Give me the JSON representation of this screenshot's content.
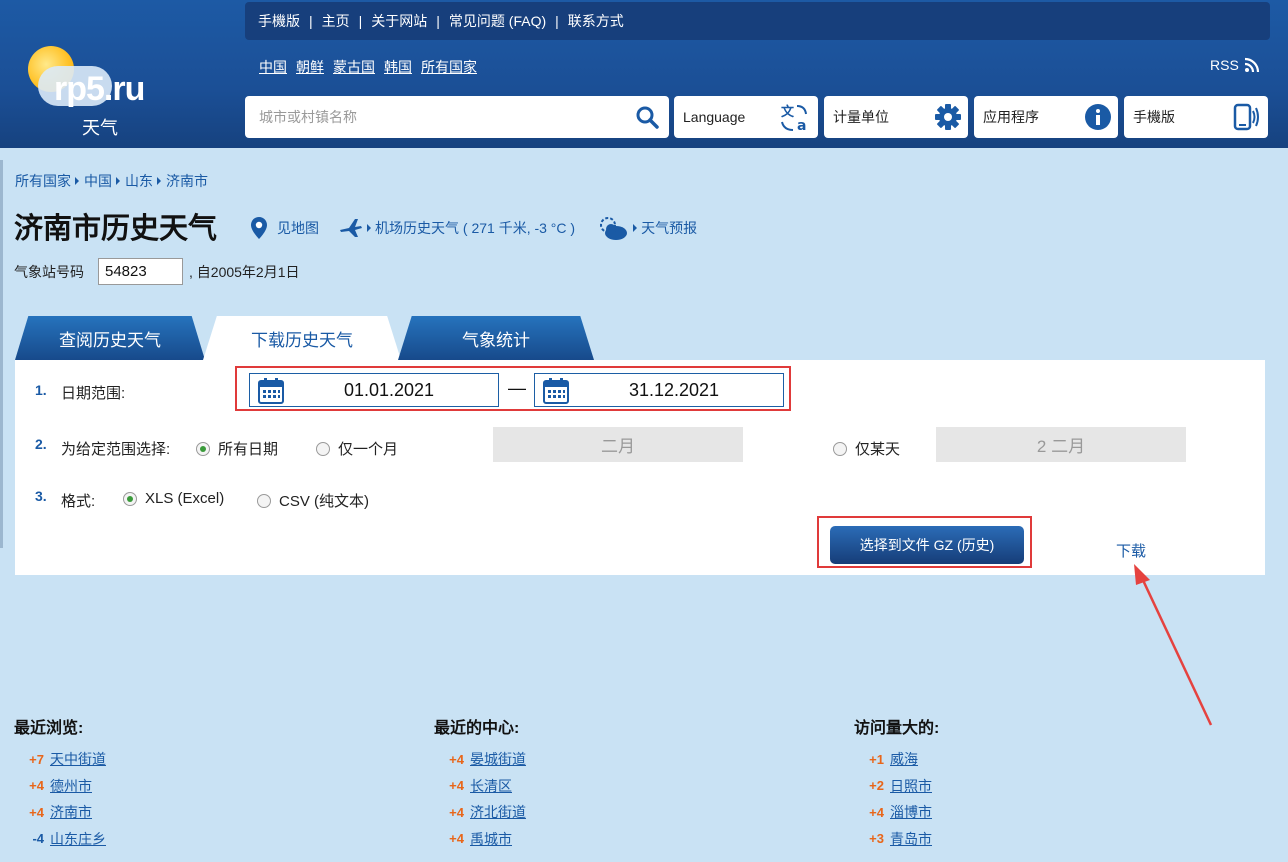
{
  "header": {
    "brand": "rp5.ru",
    "brand_sub": "天气",
    "topnav": [
      "手機版",
      "主页",
      "关于网站",
      "常见问题 (FAQ)",
      "联系方式"
    ],
    "countries": [
      "中国",
      "朝鲜",
      "蒙古国",
      "韩国",
      "所有国家"
    ],
    "rss": "RSS",
    "search_placeholder": "城市或村镇名称",
    "buttons": {
      "language": "Language",
      "units": "计量单位",
      "apps": "应用程序",
      "mobile": "手機版"
    }
  },
  "breadcrumb": [
    "所有国家",
    "中国",
    "山东",
    "济南市"
  ],
  "page": {
    "title": "济南市历史天气",
    "map_link": "见地图",
    "airport_link": "机场历史天气 ( 271 千米, -3 °C )",
    "forecast_link": "天气预报",
    "station_label": "气象站号码",
    "station_value": "54823",
    "station_since": ", 自2005年2月1日"
  },
  "tabs": [
    "查阅历史天气",
    "下载历史天气",
    "气象统计"
  ],
  "form": {
    "step1": {
      "num": "1.",
      "label": "日期范围:",
      "from": "01.01.2021",
      "to": "31.12.2021",
      "sep": "—"
    },
    "step2": {
      "num": "2.",
      "label": "为给定范围选择:",
      "opt_all": "所有日期",
      "opt_month": "仅一个月",
      "month_value": "二月",
      "opt_day": "仅某天",
      "day_value": "2 二月"
    },
    "step3": {
      "num": "3.",
      "label": "格式:",
      "opt_xls": "XLS (Excel)",
      "opt_csv": "CSV (纯文本)"
    },
    "select_button": "选择到文件 GZ (历史)",
    "download_link": "下载"
  },
  "lists": {
    "recent": {
      "title": "最近浏览:",
      "items": [
        {
          "delta": "+7",
          "city": "天中街道"
        },
        {
          "delta": "+4",
          "city": "德州市"
        },
        {
          "delta": "+4",
          "city": "济南市"
        },
        {
          "delta": "-4",
          "city": "山东庄乡"
        }
      ]
    },
    "centers": {
      "title": "最近的中心:",
      "items": [
        {
          "delta": "+4",
          "city": "晏城街道"
        },
        {
          "delta": "+4",
          "city": "长清区"
        },
        {
          "delta": "+4",
          "city": "济北街道"
        },
        {
          "delta": "+4",
          "city": "禹城市"
        }
      ]
    },
    "popular": {
      "title": "访问量大的:",
      "items": [
        {
          "delta": "+1",
          "city": "威海"
        },
        {
          "delta": "+2",
          "city": "日照市"
        },
        {
          "delta": "+4",
          "city": "淄博市"
        },
        {
          "delta": "+3",
          "city": "青岛市"
        }
      ]
    }
  },
  "colors": {
    "header_blue": "#1b4f96",
    "link_blue": "#1a5aa5",
    "highlight_red": "#e03a3a",
    "delta_orange": "#e8661a"
  }
}
